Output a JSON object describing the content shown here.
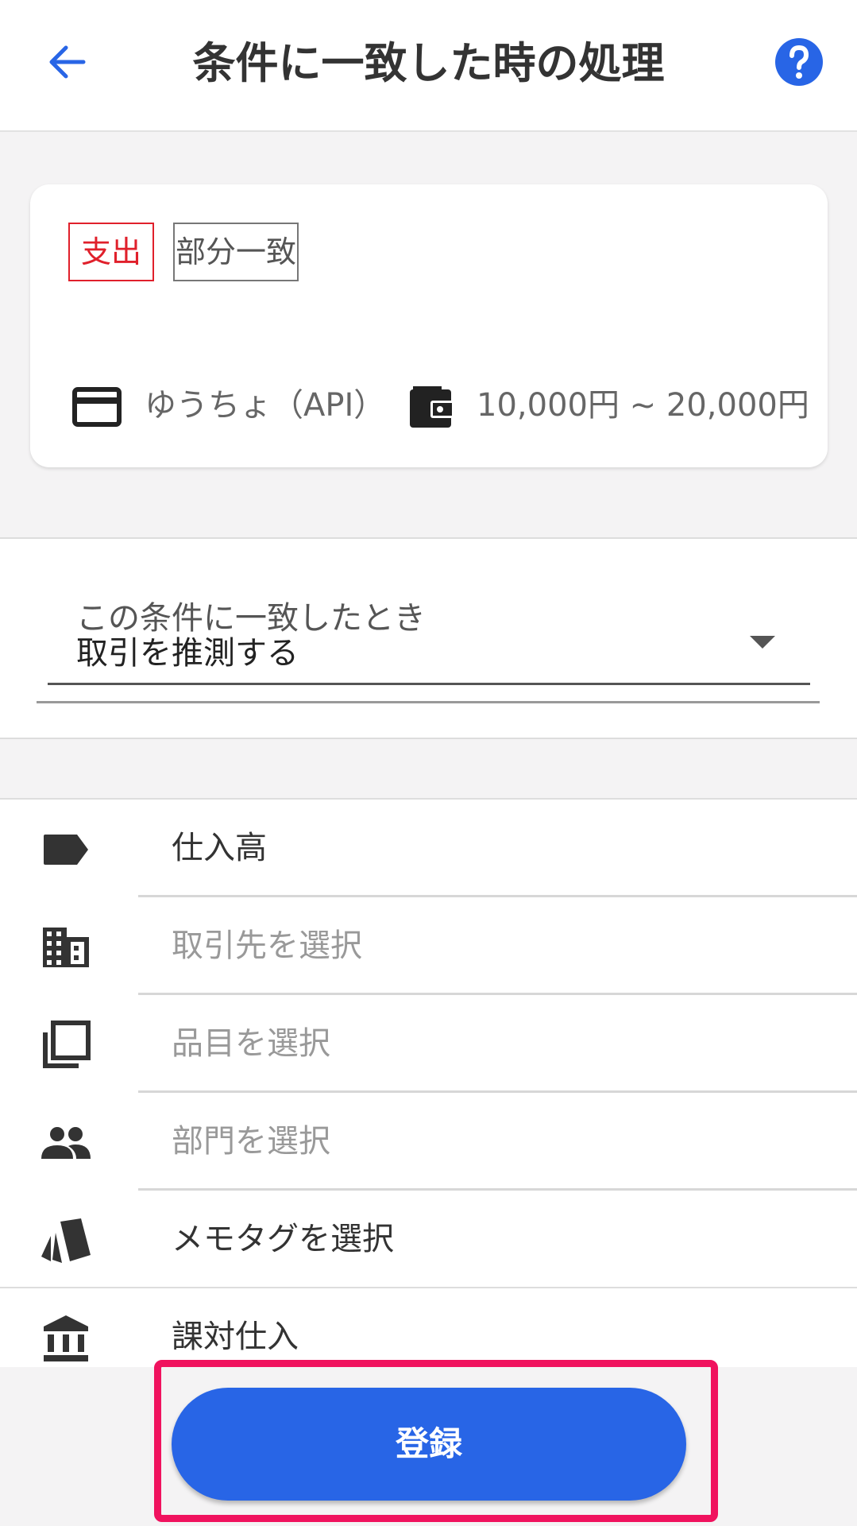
{
  "header": {
    "back_icon": "arrow-left-icon",
    "title": "条件に一致した時の処理",
    "help_icon": "question-circle-icon",
    "accent": "#2865e6"
  },
  "condition": {
    "type_badge": "支出",
    "match_badge": "部分一致",
    "account_icon": "credit-card-icon",
    "account": "ゆうちょ（API）",
    "amount_icon": "wallet-icon",
    "amount_range": "10,000円 ~ 20,000円",
    "type_color": "#e0202b"
  },
  "action": {
    "label": "この条件に一致したとき",
    "value": "取引を推測する",
    "dropdown_icon": "caret-down-icon"
  },
  "details": {
    "rows": [
      {
        "icon": "tag-icon",
        "text": "仕入高",
        "is_placeholder": false
      },
      {
        "icon": "building-icon",
        "text": "取引先を選択",
        "is_placeholder": true
      },
      {
        "icon": "copy-icon",
        "text": "品目を選択",
        "is_placeholder": true
      },
      {
        "icon": "people-icon",
        "text": "部門を選択",
        "is_placeholder": true
      },
      {
        "icon": "memo-tags-icon",
        "text": "メモタグを選択",
        "is_placeholder": false
      },
      {
        "icon": "bank-icon",
        "text": "課対仕入",
        "is_placeholder": false
      }
    ]
  },
  "footer": {
    "register_label": "登録",
    "highlight_color": "#f0125e"
  }
}
